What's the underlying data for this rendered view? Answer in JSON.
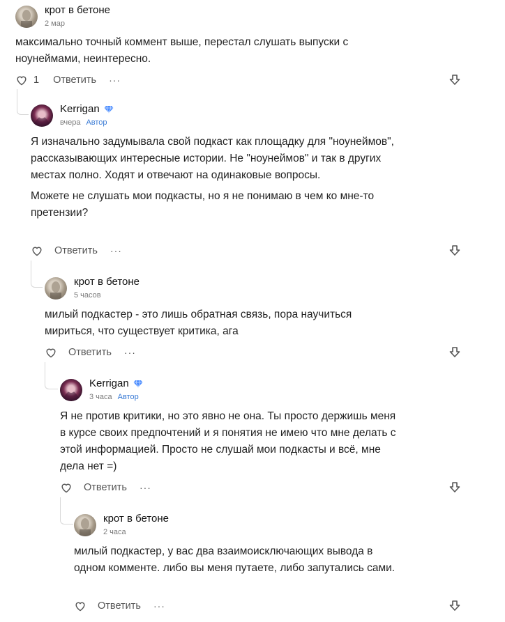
{
  "comments": [
    {
      "author": "крот в бетоне",
      "time": "2 мар",
      "badge": "",
      "paragraphs": [
        "максимально точный коммент выше, перестал слушать выпуски с ноунеймами, неинтересно."
      ],
      "likes": "1",
      "reply_label": "Ответить",
      "more_label": "···"
    },
    {
      "author": "Kerrigan",
      "time": "вчера",
      "badge": "Автор",
      "paragraphs": [
        "Я изначально задумывала свой подкаст как площадку для \"ноунеймов\", рассказывающих интересные истории. Не \"ноунеймов\" и так в других местах полно. Ходят и отвечают на одинаковые вопросы.",
        "Можете не слушать мои подкасты, но я не понимаю в чем ко мне-то претензии?"
      ],
      "likes": "",
      "reply_label": "Ответить",
      "more_label": "···"
    },
    {
      "author": "крот в бетоне",
      "time": "5 часов",
      "badge": "",
      "paragraphs": [
        "милый подкастер - это лишь обратная связь, пора научиться мириться, что существует критика, ага"
      ],
      "likes": "",
      "reply_label": "Ответить",
      "more_label": "···"
    },
    {
      "author": "Kerrigan",
      "time": "3 часа",
      "badge": "Автор",
      "paragraphs": [
        "Я не против критики, но это явно не она. Ты просто держишь меня в курсе своих предпочтений и я понятия не имею что мне делать с этой информацией. Просто не слушай мои подкасты и всё, мне дела нет =)"
      ],
      "likes": "",
      "reply_label": "Ответить",
      "more_label": "···"
    },
    {
      "author": "крот в бетоне",
      "time": "2 часа",
      "badge": "",
      "paragraphs": [
        "милый подкастер, у вас два взаимоисключающих вывода в одном комменте. либо вы меня путаете, либо запутались сами."
      ],
      "likes": "",
      "reply_label": "Ответить",
      "more_label": "···"
    }
  ],
  "icons": {
    "like": "heart-icon",
    "more": "more-dots-icon",
    "down": "down-arrow-icon",
    "verified": "gem-icon"
  },
  "colors": {
    "author_badge": "#3a7bd5",
    "gem": "#4a8cff",
    "meta": "#7a7a7a"
  }
}
